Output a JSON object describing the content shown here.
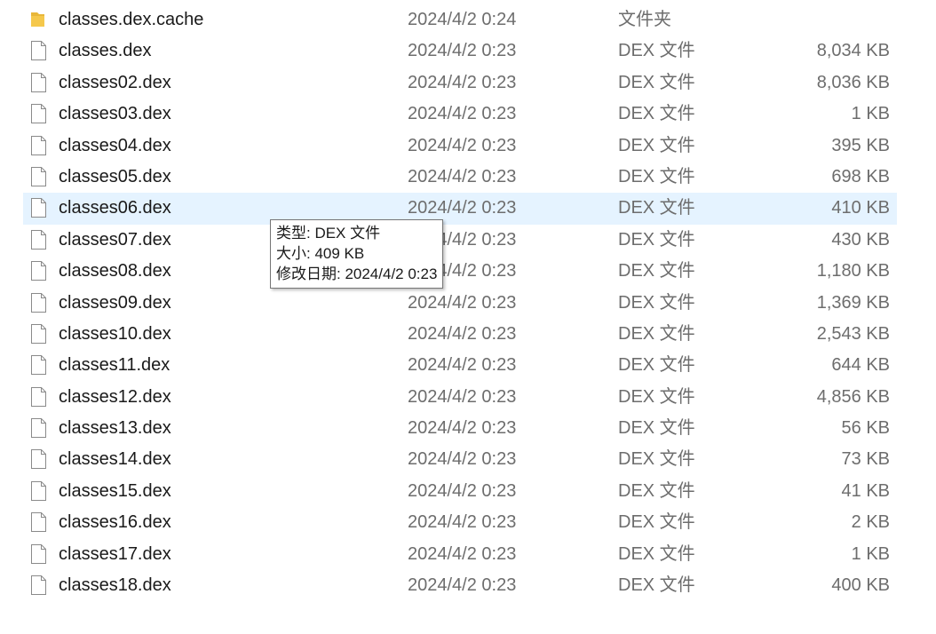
{
  "tooltip": {
    "type_line": "类型: DEX 文件",
    "size_line": "大小: 409 KB",
    "date_line": "修改日期: 2024/4/2 0:23"
  },
  "colors": {
    "hover_row": "#e5f3ff",
    "folder": "#e8b73a",
    "secondary_text": "#6d6d6d"
  },
  "files": [
    {
      "icon": "folder-icon",
      "name": "classes.dex.cache",
      "date": "2024/4/2 0:24",
      "type": "文件夹",
      "size": ""
    },
    {
      "icon": "file-icon",
      "name": "classes.dex",
      "date": "2024/4/2 0:23",
      "type": "DEX 文件",
      "size": "8,034 KB"
    },
    {
      "icon": "file-icon",
      "name": "classes02.dex",
      "date": "2024/4/2 0:23",
      "type": "DEX 文件",
      "size": "8,036 KB"
    },
    {
      "icon": "file-icon",
      "name": "classes03.dex",
      "date": "2024/4/2 0:23",
      "type": "DEX 文件",
      "size": "1 KB"
    },
    {
      "icon": "file-icon",
      "name": "classes04.dex",
      "date": "2024/4/2 0:23",
      "type": "DEX 文件",
      "size": "395 KB"
    },
    {
      "icon": "file-icon",
      "name": "classes05.dex",
      "date": "2024/4/2 0:23",
      "type": "DEX 文件",
      "size": "698 KB"
    },
    {
      "icon": "file-icon",
      "name": "classes06.dex",
      "date": "2024/4/2 0:23",
      "type": "DEX 文件",
      "size": "410 KB",
      "hover": true
    },
    {
      "icon": "file-icon",
      "name": "classes07.dex",
      "date": "2024/4/2 0:23",
      "type": "DEX 文件",
      "size": "430 KB"
    },
    {
      "icon": "file-icon",
      "name": "classes08.dex",
      "date": "2024/4/2 0:23",
      "type": "DEX 文件",
      "size": "1,180 KB"
    },
    {
      "icon": "file-icon",
      "name": "classes09.dex",
      "date": "2024/4/2 0:23",
      "type": "DEX 文件",
      "size": "1,369 KB"
    },
    {
      "icon": "file-icon",
      "name": "classes10.dex",
      "date": "2024/4/2 0:23",
      "type": "DEX 文件",
      "size": "2,543 KB"
    },
    {
      "icon": "file-icon",
      "name": "classes11.dex",
      "date": "2024/4/2 0:23",
      "type": "DEX 文件",
      "size": "644 KB"
    },
    {
      "icon": "file-icon",
      "name": "classes12.dex",
      "date": "2024/4/2 0:23",
      "type": "DEX 文件",
      "size": "4,856 KB"
    },
    {
      "icon": "file-icon",
      "name": "classes13.dex",
      "date": "2024/4/2 0:23",
      "type": "DEX 文件",
      "size": "56 KB"
    },
    {
      "icon": "file-icon",
      "name": "classes14.dex",
      "date": "2024/4/2 0:23",
      "type": "DEX 文件",
      "size": "73 KB"
    },
    {
      "icon": "file-icon",
      "name": "classes15.dex",
      "date": "2024/4/2 0:23",
      "type": "DEX 文件",
      "size": "41 KB"
    },
    {
      "icon": "file-icon",
      "name": "classes16.dex",
      "date": "2024/4/2 0:23",
      "type": "DEX 文件",
      "size": "2 KB"
    },
    {
      "icon": "file-icon",
      "name": "classes17.dex",
      "date": "2024/4/2 0:23",
      "type": "DEX 文件",
      "size": "1 KB"
    },
    {
      "icon": "file-icon",
      "name": "classes18.dex",
      "date": "2024/4/2 0:23",
      "type": "DEX 文件",
      "size": "400 KB"
    }
  ]
}
